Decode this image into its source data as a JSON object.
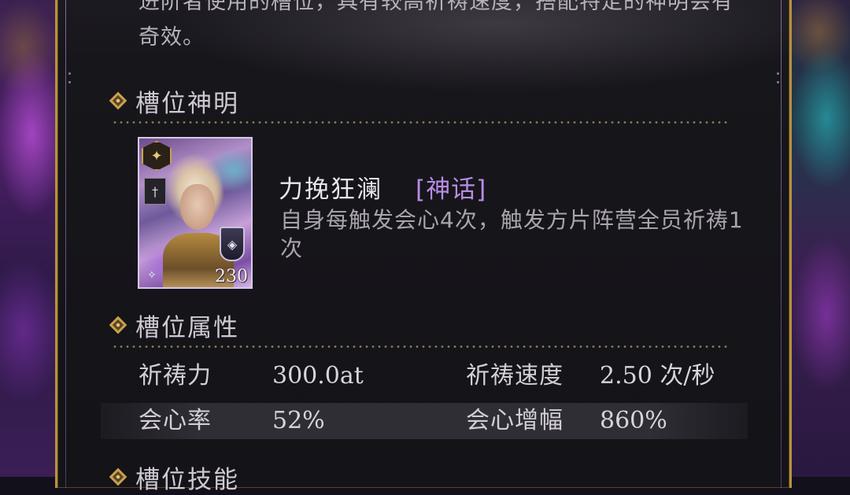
{
  "description_text": "进阶者使用的槽位，具有较高祈祷速度，搭配特定的神明会有奇效。",
  "sections": {
    "slot_god": {
      "title": "槽位神明"
    },
    "slot_attributes": {
      "title": "槽位属性"
    },
    "slot_skill": {
      "title": "槽位技能"
    }
  },
  "god": {
    "name": "力挽狂澜",
    "rarity": "[神话]",
    "rarity_color": "#b88ce6",
    "description": "自身每触发会心4次，触发方片阵营全员祈祷1次",
    "card": {
      "level": "230",
      "badge_icon": "star-emblem-icon",
      "class_icon": "sword-icon",
      "faction_icon": "shield-icon"
    }
  },
  "attributes": {
    "rows": [
      {
        "label1": "祈祷力",
        "value1": "300.0at",
        "label2": "祈祷速度",
        "value2": "2.50 次/秒"
      },
      {
        "label1": "会心率",
        "value1": "52%",
        "label2": "会心增幅",
        "value2": "860%"
      }
    ]
  },
  "colors": {
    "frame_gold": "#b8923e",
    "panel_bg": "#16151a",
    "text_primary": "#d2ced6",
    "text_secondary": "#a9a4ae"
  }
}
